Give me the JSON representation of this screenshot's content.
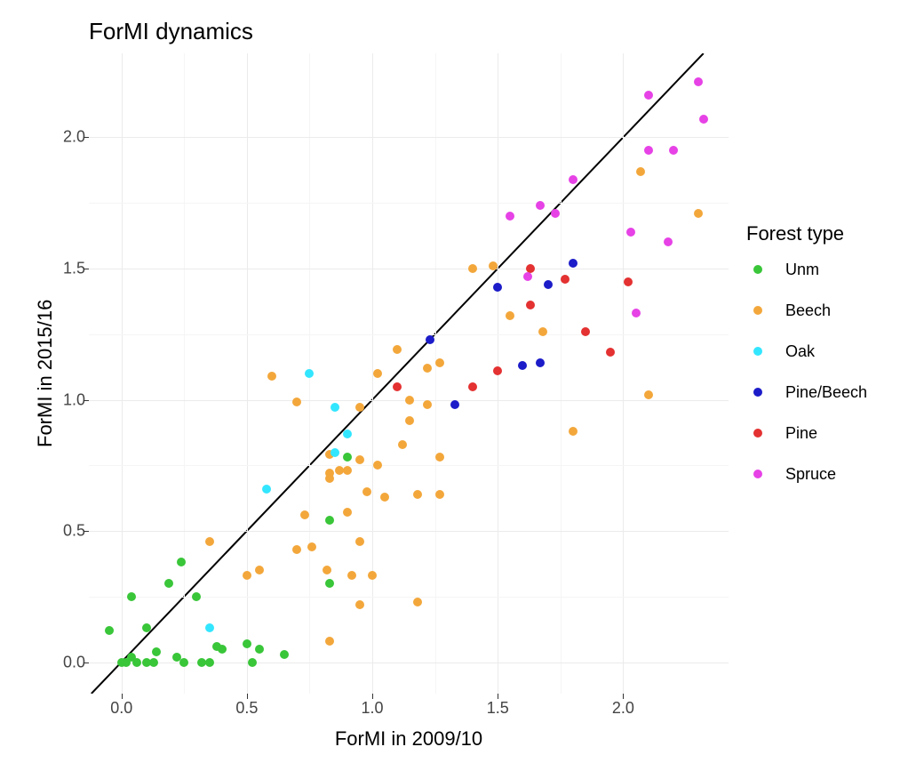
{
  "chart_data": {
    "type": "scatter",
    "title": "ForMI dynamics",
    "xlabel": "ForMI in 2009/10",
    "ylabel": "ForMI in 2015/16",
    "xlim": [
      -0.13,
      2.42
    ],
    "ylim": [
      -0.12,
      2.32
    ],
    "x_ticks": [
      0.0,
      0.5,
      1.0,
      1.5,
      2.0
    ],
    "y_ticks": [
      0.0,
      0.5,
      1.0,
      1.5,
      2.0
    ],
    "diagonal_line": {
      "slope": 1,
      "intercept": 0
    },
    "legend_title": "Forest type",
    "colors": {
      "Unm": "#39c639",
      "Beech": "#f3a73b",
      "Oak": "#33e6ff",
      "Pine/Beech": "#1c1cc9",
      "Pine": "#e43131",
      "Spruce": "#e642e6"
    },
    "series": [
      {
        "name": "Unm",
        "points": [
          {
            "x": -0.05,
            "y": 0.12
          },
          {
            "x": 0.0,
            "y": 0.0
          },
          {
            "x": 0.02,
            "y": 0.0
          },
          {
            "x": 0.04,
            "y": 0.02
          },
          {
            "x": 0.06,
            "y": 0.0
          },
          {
            "x": 0.04,
            "y": 0.25
          },
          {
            "x": 0.1,
            "y": 0.0
          },
          {
            "x": 0.1,
            "y": 0.13
          },
          {
            "x": 0.13,
            "y": 0.0
          },
          {
            "x": 0.14,
            "y": 0.04
          },
          {
            "x": 0.19,
            "y": 0.3
          },
          {
            "x": 0.22,
            "y": 0.02
          },
          {
            "x": 0.24,
            "y": 0.38
          },
          {
            "x": 0.25,
            "y": 0.0
          },
          {
            "x": 0.3,
            "y": 0.25
          },
          {
            "x": 0.32,
            "y": 0.0
          },
          {
            "x": 0.35,
            "y": 0.0
          },
          {
            "x": 0.38,
            "y": 0.06
          },
          {
            "x": 0.4,
            "y": 0.05
          },
          {
            "x": 0.5,
            "y": 0.07
          },
          {
            "x": 0.52,
            "y": 0.0
          },
          {
            "x": 0.55,
            "y": 0.05
          },
          {
            "x": 0.65,
            "y": 0.03
          },
          {
            "x": 0.83,
            "y": 0.3
          },
          {
            "x": 0.83,
            "y": 0.54
          },
          {
            "x": 0.9,
            "y": 0.78
          }
        ]
      },
      {
        "name": "Beech",
        "points": [
          {
            "x": 0.35,
            "y": 0.46
          },
          {
            "x": 0.5,
            "y": 0.33
          },
          {
            "x": 0.55,
            "y": 0.35
          },
          {
            "x": 0.6,
            "y": 1.09
          },
          {
            "x": 0.7,
            "y": 0.43
          },
          {
            "x": 0.7,
            "y": 0.99
          },
          {
            "x": 0.73,
            "y": 0.56
          },
          {
            "x": 0.76,
            "y": 0.44
          },
          {
            "x": 0.82,
            "y": 0.35
          },
          {
            "x": 0.83,
            "y": 0.7
          },
          {
            "x": 0.83,
            "y": 0.72
          },
          {
            "x": 0.83,
            "y": 0.79
          },
          {
            "x": 0.83,
            "y": 0.08
          },
          {
            "x": 0.87,
            "y": 0.73
          },
          {
            "x": 0.9,
            "y": 0.57
          },
          {
            "x": 0.9,
            "y": 0.73
          },
          {
            "x": 0.92,
            "y": 0.33
          },
          {
            "x": 0.95,
            "y": 0.22
          },
          {
            "x": 0.95,
            "y": 0.46
          },
          {
            "x": 0.95,
            "y": 0.77
          },
          {
            "x": 0.95,
            "y": 0.97
          },
          {
            "x": 0.98,
            "y": 0.65
          },
          {
            "x": 1.0,
            "y": 0.33
          },
          {
            "x": 1.02,
            "y": 0.75
          },
          {
            "x": 1.02,
            "y": 1.1
          },
          {
            "x": 1.05,
            "y": 0.63
          },
          {
            "x": 1.1,
            "y": 1.19
          },
          {
            "x": 1.12,
            "y": 0.83
          },
          {
            "x": 1.15,
            "y": 0.92
          },
          {
            "x": 1.15,
            "y": 1.0
          },
          {
            "x": 1.18,
            "y": 0.23
          },
          {
            "x": 1.18,
            "y": 0.64
          },
          {
            "x": 1.22,
            "y": 0.98
          },
          {
            "x": 1.22,
            "y": 1.12
          },
          {
            "x": 1.27,
            "y": 1.14
          },
          {
            "x": 1.27,
            "y": 0.78
          },
          {
            "x": 1.27,
            "y": 0.64
          },
          {
            "x": 1.4,
            "y": 1.5
          },
          {
            "x": 1.48,
            "y": 1.51
          },
          {
            "x": 1.55,
            "y": 1.32
          },
          {
            "x": 1.68,
            "y": 1.26
          },
          {
            "x": 1.8,
            "y": 0.88
          },
          {
            "x": 2.07,
            "y": 1.87
          },
          {
            "x": 2.1,
            "y": 1.02
          },
          {
            "x": 2.3,
            "y": 1.71
          }
        ]
      },
      {
        "name": "Oak",
        "points": [
          {
            "x": 0.35,
            "y": 0.13
          },
          {
            "x": 0.58,
            "y": 0.66
          },
          {
            "x": 0.75,
            "y": 1.1
          },
          {
            "x": 0.85,
            "y": 0.97
          },
          {
            "x": 0.85,
            "y": 0.8
          },
          {
            "x": 0.9,
            "y": 0.87
          }
        ]
      },
      {
        "name": "Pine/Beech",
        "points": [
          {
            "x": 1.23,
            "y": 1.23
          },
          {
            "x": 1.33,
            "y": 0.98
          },
          {
            "x": 1.5,
            "y": 1.43
          },
          {
            "x": 1.6,
            "y": 1.13
          },
          {
            "x": 1.67,
            "y": 1.14
          },
          {
            "x": 1.7,
            "y": 1.44
          },
          {
            "x": 1.8,
            "y": 1.52
          }
        ]
      },
      {
        "name": "Pine",
        "points": [
          {
            "x": 1.1,
            "y": 1.05
          },
          {
            "x": 1.4,
            "y": 1.05
          },
          {
            "x": 1.5,
            "y": 1.11
          },
          {
            "x": 1.63,
            "y": 1.36
          },
          {
            "x": 1.63,
            "y": 1.5
          },
          {
            "x": 1.77,
            "y": 1.46
          },
          {
            "x": 1.85,
            "y": 1.26
          },
          {
            "x": 1.95,
            "y": 1.18
          },
          {
            "x": 2.02,
            "y": 1.45
          }
        ]
      },
      {
        "name": "Spruce",
        "points": [
          {
            "x": 1.55,
            "y": 1.7
          },
          {
            "x": 1.62,
            "y": 1.47
          },
          {
            "x": 1.67,
            "y": 1.74
          },
          {
            "x": 1.73,
            "y": 1.71
          },
          {
            "x": 1.8,
            "y": 1.84
          },
          {
            "x": 2.03,
            "y": 1.64
          },
          {
            "x": 2.05,
            "y": 1.33
          },
          {
            "x": 2.1,
            "y": 1.95
          },
          {
            "x": 2.1,
            "y": 2.16
          },
          {
            "x": 2.18,
            "y": 1.6
          },
          {
            "x": 2.2,
            "y": 1.95
          },
          {
            "x": 2.3,
            "y": 2.21
          },
          {
            "x": 2.32,
            "y": 2.07
          }
        ]
      }
    ]
  }
}
